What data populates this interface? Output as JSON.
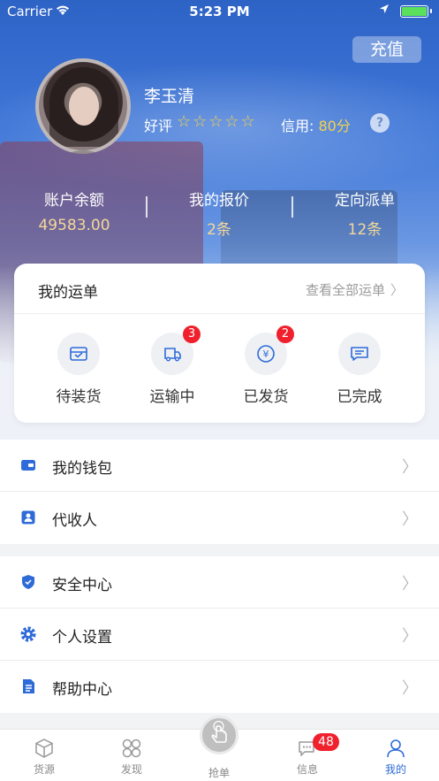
{
  "status_bar": {
    "carrier": "Carrier",
    "time": "5:23 PM"
  },
  "header": {
    "recharge_label": "充值",
    "username": "李玉清",
    "rating_label": "好评",
    "stars": "☆☆☆☆☆",
    "credit_label": "信用:",
    "credit_value": "80分",
    "help_icon_text": "?"
  },
  "stats": [
    {
      "label": "账户余额",
      "value": "49583.00"
    },
    {
      "label": "我的报价",
      "value": "2条"
    },
    {
      "label": "定向派单",
      "value": "12条"
    }
  ],
  "orders": {
    "title": "我的运单",
    "view_all": "查看全部运单",
    "items": [
      {
        "label": "待装货",
        "icon": "box-icon",
        "badge": ""
      },
      {
        "label": "运输中",
        "icon": "truck-icon",
        "badge": "3"
      },
      {
        "label": "已发货",
        "icon": "yuan-icon",
        "badge": "2"
      },
      {
        "label": "已完成",
        "icon": "message-icon",
        "badge": ""
      }
    ]
  },
  "menu_group1": [
    {
      "label": "我的钱包",
      "icon": "wallet-icon"
    },
    {
      "label": "代收人",
      "icon": "payee-icon"
    }
  ],
  "menu_group2": [
    {
      "label": "安全中心",
      "icon": "shield-icon"
    },
    {
      "label": "个人设置",
      "icon": "settings-icon"
    },
    {
      "label": "帮助中心",
      "icon": "document-icon"
    }
  ],
  "tabbar": {
    "tabs": [
      {
        "label": "货源",
        "icon": "cube-icon"
      },
      {
        "label": "发现",
        "icon": "discover-icon"
      },
      {
        "label": "抢单",
        "icon": "tap-icon"
      },
      {
        "label": "信息",
        "icon": "chat-icon",
        "badge": "48"
      },
      {
        "label": "我的",
        "icon": "user-icon"
      }
    ],
    "active": "我的"
  },
  "colors": {
    "primary": "#2e6bd8",
    "badge": "#f0202c",
    "gold": "#f4d79a"
  }
}
